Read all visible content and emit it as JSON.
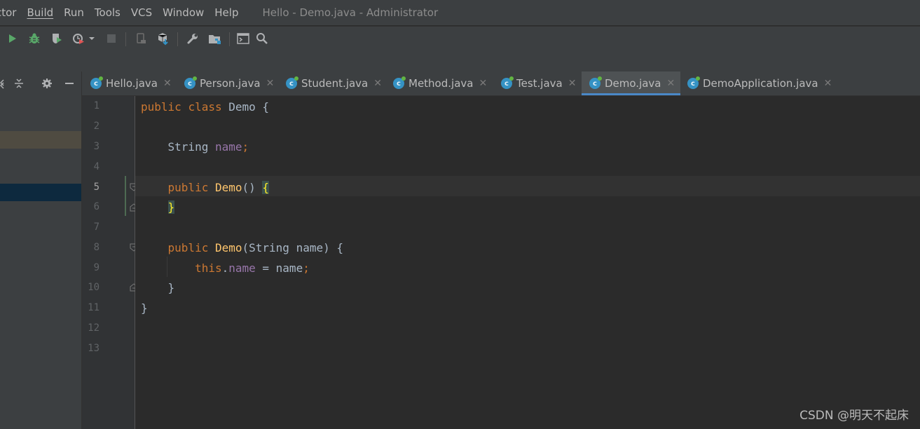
{
  "menu": {
    "items": [
      "ctor",
      "Build",
      "Run",
      "Tools",
      "VCS",
      "Window",
      "Help"
    ],
    "window_title": "Hello - Demo.java - Administrator"
  },
  "toolbar": {
    "icons": [
      "run-icon",
      "debug-icon",
      "coverage-icon",
      "profile-icon",
      "dropdown-icon",
      "stop-icon",
      "device-icon",
      "build-artifact-icon",
      "wrench-icon",
      "project-structure-icon",
      "terminal-icon",
      "search-icon"
    ]
  },
  "tabs": [
    {
      "label": "Hello.java",
      "active": false
    },
    {
      "label": "Person.java",
      "active": false
    },
    {
      "label": "Student.java",
      "active": false
    },
    {
      "label": "Method.java",
      "active": false
    },
    {
      "label": "Test.java",
      "active": false
    },
    {
      "label": "Demo.java",
      "active": true
    },
    {
      "label": "DemoApplication.java",
      "active": false
    }
  ],
  "tab_icon_letter": "c",
  "close_glyph": "✕",
  "line_numbers": [
    "1",
    "2",
    "3",
    "4",
    "5",
    "6",
    "7",
    "8",
    "9",
    "10",
    "11",
    "12",
    "13"
  ],
  "current_line": "5",
  "code": {
    "l1": {
      "kw1": "public",
      "kw2": "class",
      "name": "Demo",
      "brace": "{"
    },
    "l3": {
      "type": "String",
      "field": "name",
      "semi": ";"
    },
    "l5": {
      "kw": "public",
      "method": "Demo",
      "parens": "()",
      "brace": "{"
    },
    "l6": {
      "brace": "}"
    },
    "l8": {
      "kw": "public",
      "method": "Demo",
      "params": "(String name)",
      "brace": "{"
    },
    "l9": {
      "kw": "this",
      "dot": ".",
      "field": "name",
      "rest": " = name",
      "semi": ";"
    },
    "l10": {
      "brace": "}"
    },
    "l11": {
      "brace": "}"
    }
  },
  "watermark": "CSDN @明天不起床",
  "colors": {
    "keyword": "#cc7832",
    "field": "#9876aa",
    "method": "#ffc66d",
    "text": "#a9b7c6",
    "accent": "#4a88c7"
  }
}
